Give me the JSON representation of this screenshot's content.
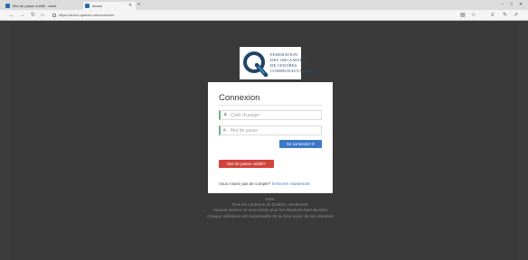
{
  "browser": {
    "tabs": [
      {
        "label": "Mot de passe oublié - reset"
      },
      {
        "label": "Accès"
      }
    ],
    "new_tab_label": "+",
    "url": "https://acces.quebec.ca/connexion",
    "window_controls": [
      "–",
      "□",
      "✕"
    ]
  },
  "logo": {
    "lines": [
      "FEDERATION",
      "DES ORGANISMES",
      "DE CENTRES",
      "COMMUNAUTAIRES"
    ]
  },
  "login": {
    "title": "Connexion",
    "username_placeholder": "Code d'usager",
    "password_placeholder": "Mot de passe",
    "connect_label": "Se connecter ⟳",
    "forgot_label": "Mot de passe oublié?",
    "signup_prompt": "Vous n'avez pas de compte?",
    "signup_link": "S'inscrire maintenant"
  },
  "footer": {
    "lines": [
      "Note:",
      "Tous les contenus de Québec, seulement.",
      "Aucune licence ne sera émise pour les résidents hors-du-Mea",
      "Chaque utilisateur est responsable de la mise à jour de ses données"
    ]
  }
}
